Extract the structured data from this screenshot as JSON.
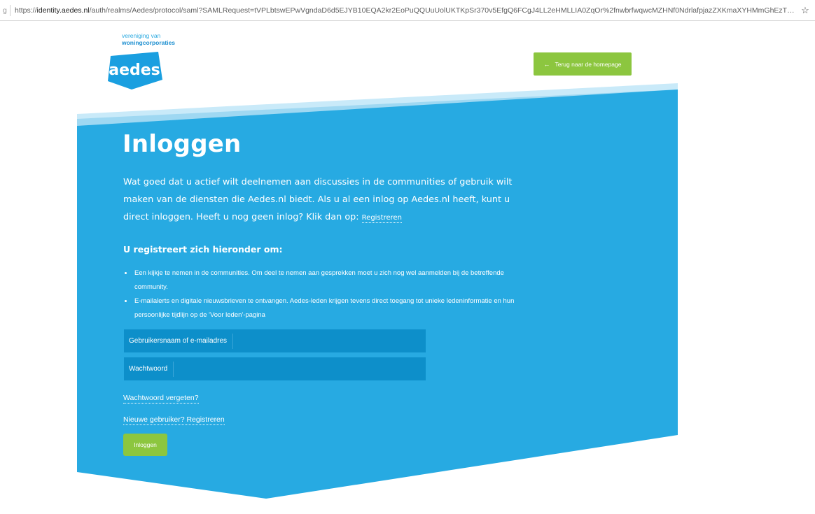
{
  "browser": {
    "url_prefix": "https://",
    "url_host": "identity.aedes.nl",
    "url_path": "/auth/realms/Aedes/protocol/saml?SAMLRequest=tVPLbtswEPwVgndaD6d5EJYB10EQA2kr2EoPuQQUuUolUKTKpSr370v5EfgQ6FCgJ4LL2eHMLLIA0ZqOr%2fnwbrfwqwcMZHNf0NdrlafpjazZXKmaXYHMmGhEzTJ1l6dXN3d5ns0p%2bQketbMFzWcpJRv..."
  },
  "logo": {
    "tagline_top": "vereniging van",
    "tagline_bottom": "woningcorporaties",
    "wordmark": "aedes"
  },
  "header": {
    "back_label": "Terug naar de homepage",
    "back_arrow": "←"
  },
  "main": {
    "title": "Inloggen",
    "intro_text": "Wat goed dat u actief wilt deelnemen aan discussies in de communities of gebruik wilt maken van de diensten die Aedes.nl biedt. Als u al een inlog op Aedes.nl heeft, kunt u direct inloggen. Heeft u nog geen inlog? Klik dan op:",
    "intro_link": "Registreren",
    "subheading": "U registreert zich hieronder om:",
    "bullets": [
      "Een kijkje te nemen in de communities. Om deel te nemen aan gesprekken moet u zich nog wel aanmelden bij de betreffende community.",
      "E-mailalerts en digitale nieuwsbrieven te ontvangen. Aedes-leden krijgen tevens direct toegang tot unieke ledeninformatie en hun persoonlijke tijdlijn op de 'Voor leden'-pagina"
    ]
  },
  "form": {
    "username_label": "Gebruikersnaam of e-mailadres",
    "username_value": "",
    "password_label": "Wachtwoord",
    "password_value": "",
    "forgot_link": "Wachtwoord vergeten?",
    "register_link": "Nieuwe gebruiker? Registreren",
    "submit_label": "Inloggen"
  },
  "colors": {
    "panel_blue": "#27aae2",
    "panel_stripe": "#9fd8f2",
    "panel_stripe_light": "#c9eaf9",
    "field_blue": "#0d8fca",
    "accent_green": "#8cc63f",
    "logo_blue": "#1a9fe0"
  }
}
